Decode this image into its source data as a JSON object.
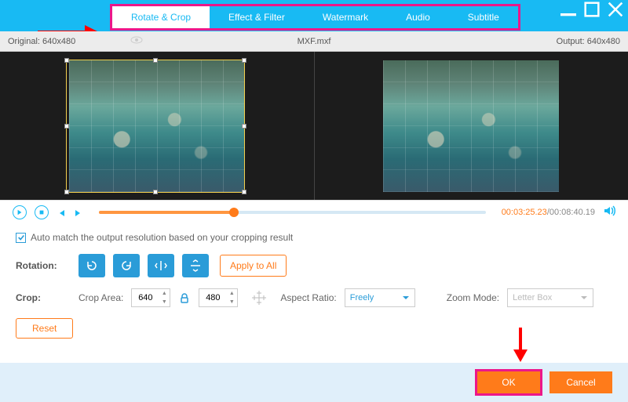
{
  "tabs": [
    "Rotate & Crop",
    "Effect & Filter",
    "Watermark",
    "Audio",
    "Subtitle"
  ],
  "info": {
    "original": "Original: 640x480",
    "filename": "MXF.mxf",
    "output": "Output: 640x480"
  },
  "time": {
    "current": "00:03:25.23",
    "sep": "/",
    "total": "00:08:40.19"
  },
  "automatch": "Auto match the output resolution based on your cropping result",
  "rotation_label": "Rotation:",
  "apply_all": "Apply to All",
  "crop_label": "Crop:",
  "crop_area_label": "Crop Area:",
  "crop_w": "640",
  "crop_h": "480",
  "aspect_label": "Aspect Ratio:",
  "aspect_value": "Freely",
  "zoom_label": "Zoom Mode:",
  "zoom_value": "Letter Box",
  "reset": "Reset",
  "ok": "OK",
  "cancel": "Cancel"
}
